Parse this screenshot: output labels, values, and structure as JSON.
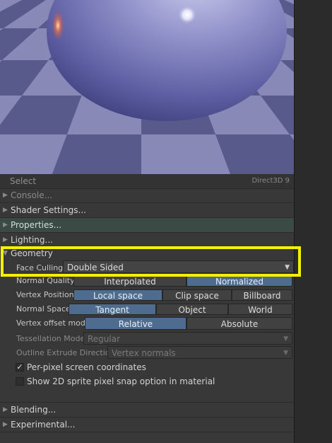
{
  "viewport": {
    "colors": {
      "tile_light": "#8889b7",
      "tile_dark": "#585a8c",
      "sphere": "#7a7bb8"
    }
  },
  "toolbar": {
    "select_label": "Select",
    "renderer_label": "Direct3D 9"
  },
  "sections": {
    "console": "Console...",
    "shader_settings": "Shader Settings...",
    "properties": "Properties...",
    "lighting": "Lighting...",
    "geometry": "Geometry",
    "blending": "Blending...",
    "experimental": "Experimental..."
  },
  "geometry": {
    "face_culling": {
      "label": "Face Culling",
      "value": "Double Sided"
    },
    "normal_quality": {
      "label": "Normal Quality",
      "options": [
        "Interpolated",
        "Normalized"
      ],
      "selected": "Normalized"
    },
    "vertex_positioning": {
      "label": "Vertex Positioning",
      "options": [
        "Local space",
        "Clip space",
        "Billboard"
      ],
      "selected": "Local space"
    },
    "normal_space": {
      "label": "Normal Space",
      "options": [
        "Tangent",
        "Object",
        "World"
      ],
      "selected": "Tangent"
    },
    "vertex_offset_mode": {
      "label": "Vertex offset mode",
      "options": [
        "Relative",
        "Absolute"
      ],
      "selected": "Relative"
    },
    "tessellation_mode": {
      "label": "Tessellation Mode",
      "value": "Regular"
    },
    "outline_extrude_direction": {
      "label": "Outline Extrude Direction",
      "value": "Vertex normals"
    },
    "per_pixel_screen_coords": {
      "label": "Per-pixel screen coordinates",
      "checked": true,
      "mark": "✓"
    },
    "sprite_pixel_snap": {
      "label": "Show 2D sprite pixel snap option in material",
      "checked": false
    }
  },
  "colors": {
    "accent": "#4d6c90",
    "highlight": "#f5f000",
    "panel": "#383838"
  }
}
